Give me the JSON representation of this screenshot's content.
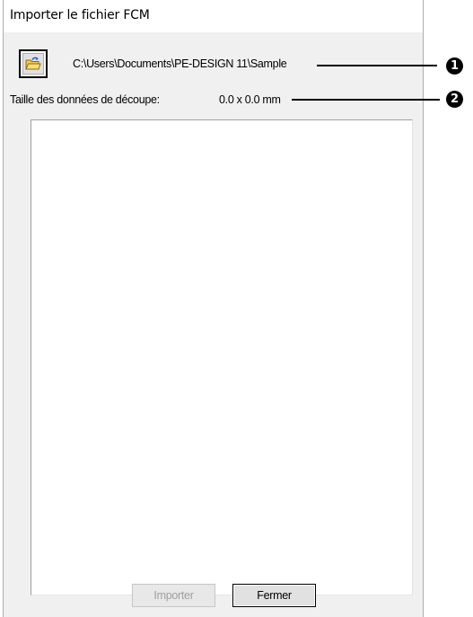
{
  "window": {
    "title": "Importer le fichier FCM"
  },
  "toolbar": {
    "open_folder_icon": "open-folder-icon",
    "path": "C:\\Users\\Documents\\PE-DESIGN 11\\Sample"
  },
  "cut_data": {
    "label": "Taille des données de découpe:",
    "value": "0.0 x 0.0 mm"
  },
  "buttons": {
    "import_label": "Importer",
    "close_label": "Fermer"
  },
  "callouts": [
    {
      "number": "1"
    },
    {
      "number": "2"
    }
  ],
  "colors": {
    "dialog_bg": "#f0f0f0",
    "callout": "#000000",
    "folder_yellow": "#f2c94c",
    "arrow_blue": "#1a5fd1"
  }
}
